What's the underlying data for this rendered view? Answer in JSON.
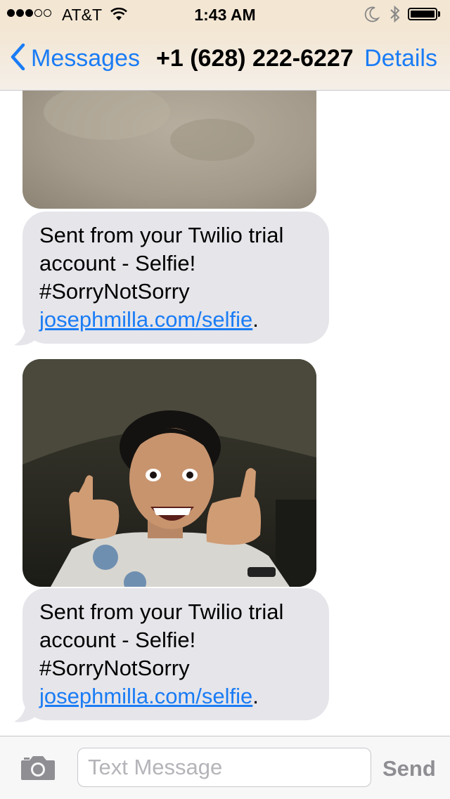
{
  "status_bar": {
    "signal_dots": [
      true,
      true,
      true,
      false,
      false
    ],
    "carrier": "AT&T",
    "time": "1:43 AM",
    "icons": [
      "wifi-icon",
      "moon-icon",
      "bluetooth-icon",
      "battery-icon"
    ]
  },
  "nav": {
    "back_label": "Messages",
    "title": "+1 (628) 222-6227",
    "details_label": "Details"
  },
  "messages": [
    {
      "type": "image",
      "description_icon": "photo-attachment"
    },
    {
      "type": "text",
      "lines": [
        "Sent from your Twilio trial",
        "account - Selfie!",
        "#SorryNotSorry"
      ],
      "link": "josephmilla.com/selfie",
      "link_suffix": "."
    },
    {
      "type": "image",
      "description_icon": "photo-attachment"
    },
    {
      "type": "text",
      "lines": [
        "Sent from your Twilio trial",
        "account - Selfie!",
        "#SorryNotSorry"
      ],
      "link": "josephmilla.com/selfie",
      "link_suffix": "."
    }
  ],
  "input_bar": {
    "placeholder": "Text Message",
    "value": "",
    "send_label": "Send",
    "camera_icon": "camera-icon"
  },
  "colors": {
    "accent": "#1a7cf5",
    "bubble_received": "#e5e5ea",
    "bar_tint": "#f3e6d3"
  }
}
